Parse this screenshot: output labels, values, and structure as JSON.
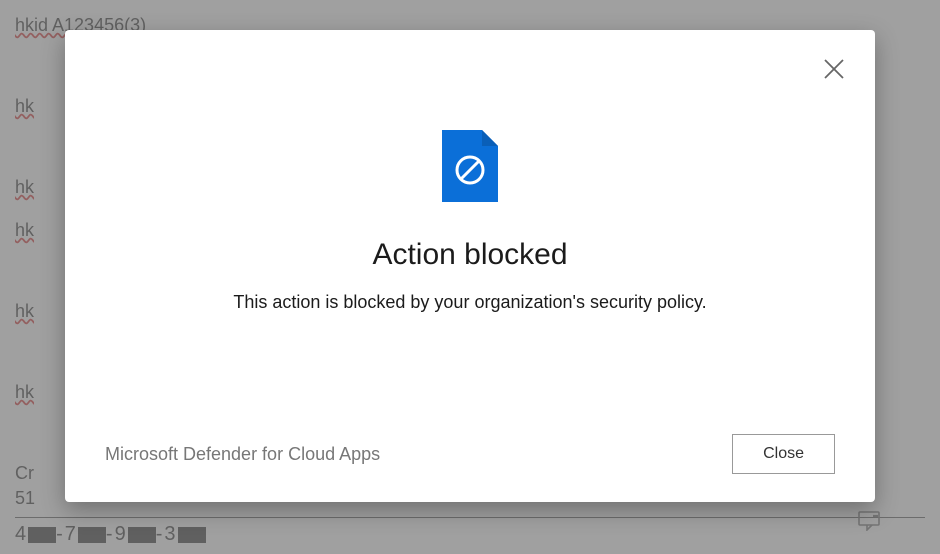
{
  "background": {
    "lines": [
      "hkid A123456(3)",
      "hk",
      "hk",
      "hk",
      "hk",
      "hk"
    ],
    "labels": {
      "creditPrefix": "Cr",
      "number": "51"
    },
    "redactedPrefix": "4",
    "redactedSegments": [
      "-7",
      "-9",
      "-3"
    ]
  },
  "modal": {
    "title": "Action blocked",
    "message": "This action is blocked by your organization's security policy.",
    "brand": "Microsoft Defender for Cloud Apps",
    "closeLabel": "Close"
  },
  "colors": {
    "accent": "#0b6fd8",
    "iconBlue": "#0b6fd8"
  }
}
